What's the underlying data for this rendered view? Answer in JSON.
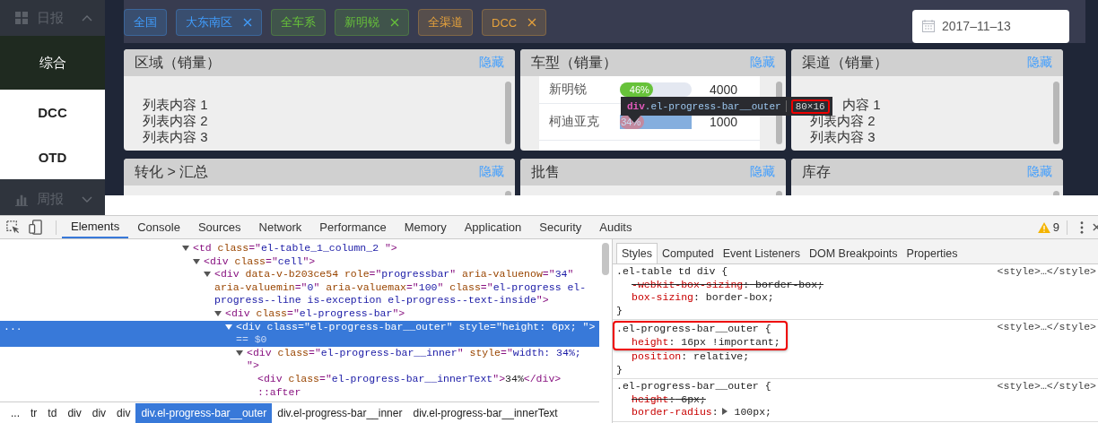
{
  "sidebar": {
    "groups": [
      {
        "label": "日报",
        "expanded": true,
        "items": [
          {
            "label": "综合",
            "selected": true
          },
          {
            "label": "DCC",
            "selected": false
          },
          {
            "label": "OTD",
            "selected": false
          }
        ]
      },
      {
        "label": "周报",
        "expanded": false
      }
    ]
  },
  "filter_tags": [
    {
      "label": "全国",
      "closable": false,
      "color": "#409eff"
    },
    {
      "label": "大东南区",
      "closable": true,
      "color": "#409eff"
    },
    {
      "label": "全车系",
      "closable": false,
      "color": "#67c23a"
    },
    {
      "label": "新明锐",
      "closable": true,
      "color": "#67c23a"
    },
    {
      "label": "全渠道",
      "closable": false,
      "color": "#e6a23c"
    },
    {
      "label": "DCC",
      "closable": true,
      "color": "#e6a23c"
    }
  ],
  "date_picker": {
    "value": "2017–11–13"
  },
  "panels": [
    {
      "title": "区域（销量）",
      "action": "隐藏",
      "kind": "list",
      "items": [
        {
          "text": "列表内容 1",
          "covered": false
        },
        {
          "text": "列表内容 2",
          "covered": false
        },
        {
          "text": "列表内容 3",
          "covered": false
        }
      ]
    },
    {
      "title": "车型（销量）",
      "action": "隐藏",
      "kind": "table",
      "rows": [
        {
          "name": "新明锐",
          "percent": "46%",
          "level": 0.46,
          "kind": "success",
          "inspected": false,
          "value": "4000"
        },
        {
          "name": "柯迪亚克",
          "percent": "34%",
          "level": 0.34,
          "kind": "exception",
          "inspected": true,
          "value": "1000"
        }
      ]
    },
    {
      "title": "渠道（销量）",
      "action": "隐藏",
      "kind": "list",
      "items": [
        {
          "text": "内容 1",
          "covered": true
        },
        {
          "text": "列表内容 2",
          "covered": false
        },
        {
          "text": "列表内容 3",
          "covered": false
        }
      ]
    },
    {
      "title": "转化 > 汇总",
      "action": "隐藏",
      "kind": "empty"
    },
    {
      "title": "批售",
      "action": "隐藏",
      "kind": "empty"
    },
    {
      "title": "库存",
      "action": "隐藏",
      "kind": "empty"
    }
  ],
  "inspect_tooltip": {
    "tag": "div",
    "classes": ".el-progress-bar__outer",
    "size": "80×16",
    "size_highlighted": true
  },
  "devtools": {
    "tabs": [
      {
        "label": "Elements",
        "selected": true
      },
      {
        "label": "Console",
        "selected": false
      },
      {
        "label": "Sources",
        "selected": false
      },
      {
        "label": "Network",
        "selected": false
      },
      {
        "label": "Performance",
        "selected": false
      },
      {
        "label": "Memory",
        "selected": false
      },
      {
        "label": "Application",
        "selected": false
      },
      {
        "label": "Security",
        "selected": false
      },
      {
        "label": "Audits",
        "selected": false
      }
    ],
    "warning_count": "9",
    "dom_tree": [
      {
        "expanded": true,
        "selected": false,
        "tokens": [
          {
            "kind": "tag",
            "t": "<td "
          },
          {
            "kind": "attr",
            "t": "class"
          },
          {
            "kind": "tag",
            "t": "=\""
          },
          {
            "kind": "val",
            "t": "el-table_1_column_2  "
          },
          {
            "kind": "tag",
            "t": "\">"
          }
        ],
        "children": [
          {
            "expanded": true,
            "selected": false,
            "tokens": [
              {
                "kind": "tag",
                "t": "<div "
              },
              {
                "kind": "attr",
                "t": "class"
              },
              {
                "kind": "tag",
                "t": "=\""
              },
              {
                "kind": "val",
                "t": "cell"
              },
              {
                "kind": "tag",
                "t": "\">"
              }
            ],
            "children": [
              {
                "expanded": true,
                "selected": false,
                "tokens": [
                  {
                    "kind": "tag",
                    "t": "<div "
                  },
                  {
                    "kind": "attr",
                    "t": "data-v-b203ce54 role"
                  },
                  {
                    "kind": "tag",
                    "t": "=\""
                  },
                  {
                    "kind": "val",
                    "t": "progressbar"
                  },
                  {
                    "kind": "tag",
                    "t": "\" "
                  },
                  {
                    "kind": "attr",
                    "t": "aria-valuenow"
                  },
                  {
                    "kind": "tag",
                    "t": "=\""
                  },
                  {
                    "kind": "val",
                    "t": "34"
                  },
                  {
                    "kind": "tag",
                    "t": "\" "
                  },
                  {
                    "kind": "attr",
                    "t": "aria-valuemin"
                  },
                  {
                    "kind": "tag",
                    "t": "=\""
                  },
                  {
                    "kind": "val",
                    "t": "0"
                  },
                  {
                    "kind": "tag",
                    "t": "\" "
                  },
                  {
                    "kind": "attr",
                    "t": "aria-valuemax"
                  },
                  {
                    "kind": "tag",
                    "t": "=\""
                  },
                  {
                    "kind": "val",
                    "t": "100"
                  },
                  {
                    "kind": "tag",
                    "t": "\" "
                  },
                  {
                    "kind": "attr",
                    "t": "class"
                  },
                  {
                    "kind": "tag",
                    "t": "=\""
                  },
                  {
                    "kind": "val",
                    "t": "el-progress el-progress--line is-exception el-progress--text-inside"
                  },
                  {
                    "kind": "tag",
                    "t": "\">"
                  }
                ],
                "children": [
                  {
                    "expanded": true,
                    "selected": false,
                    "tokens": [
                      {
                        "kind": "tag",
                        "t": "<div "
                      },
                      {
                        "kind": "attr",
                        "t": "class"
                      },
                      {
                        "kind": "tag",
                        "t": "=\""
                      },
                      {
                        "kind": "val",
                        "t": "el-progress-bar"
                      },
                      {
                        "kind": "tag",
                        "t": "\">"
                      }
                    ],
                    "children": [
                      {
                        "expanded": true,
                        "selected": true,
                        "gutter": "...",
                        "tokens": [
                          {
                            "kind": "tag",
                            "t": "<div "
                          },
                          {
                            "kind": "attr",
                            "t": "class"
                          },
                          {
                            "kind": "tag",
                            "t": "=\""
                          },
                          {
                            "kind": "val",
                            "t": "el-progress-bar__outer"
                          },
                          {
                            "kind": "tag",
                            "t": "\" "
                          },
                          {
                            "kind": "attr",
                            "t": "style"
                          },
                          {
                            "kind": "tag",
                            "t": "=\""
                          },
                          {
                            "kind": "val",
                            "t": "height: 6px; "
                          },
                          {
                            "kind": "tag",
                            "t": "\">"
                          },
                          {
                            "kind": "ref",
                            "t": " == $0"
                          }
                        ],
                        "children": [
                          {
                            "expanded": true,
                            "selected": false,
                            "tokens": [
                              {
                                "kind": "tag",
                                "t": "<div "
                              },
                              {
                                "kind": "attr",
                                "t": "class"
                              },
                              {
                                "kind": "tag",
                                "t": "=\""
                              },
                              {
                                "kind": "val",
                                "t": "el-progress-bar__inner"
                              },
                              {
                                "kind": "tag",
                                "t": "\" "
                              },
                              {
                                "kind": "attr",
                                "t": "style"
                              },
                              {
                                "kind": "tag",
                                "t": "=\""
                              },
                              {
                                "kind": "val",
                                "t": "width: 34%; "
                              },
                              {
                                "kind": "tag",
                                "t": "\">"
                              }
                            ],
                            "children": [
                              {
                                "selected": false,
                                "tokens": [
                                  {
                                    "kind": "tag",
                                    "t": "<div "
                                  },
                                  {
                                    "kind": "attr",
                                    "t": "class"
                                  },
                                  {
                                    "kind": "tag",
                                    "t": "=\""
                                  },
                                  {
                                    "kind": "val",
                                    "t": "el-progress-bar__innerText"
                                  },
                                  {
                                    "kind": "tag",
                                    "t": "\">"
                                  },
                                  {
                                    "kind": "text",
                                    "t": "34%"
                                  },
                                  {
                                    "kind": "tag",
                                    "t": "</div>"
                                  }
                                ]
                              },
                              {
                                "selected": false,
                                "tokens": [
                                  {
                                    "kind": "tag",
                                    "t": "::after"
                                  }
                                ]
                              }
                            ]
                          }
                        ]
                      }
                    ]
                  }
                ]
              }
            ]
          }
        ]
      }
    ],
    "breadcrumbs": [
      {
        "label": "...",
        "selected": false
      },
      {
        "label": "tr",
        "selected": false
      },
      {
        "label": "td",
        "selected": false
      },
      {
        "label": "div",
        "selected": false
      },
      {
        "label": "div",
        "selected": false
      },
      {
        "label": "div",
        "selected": false
      },
      {
        "label": "div.el-progress-bar__outer",
        "selected": true
      },
      {
        "label": "div.el-progress-bar__inner",
        "selected": false
      },
      {
        "label": "div.el-progress-bar__innerText",
        "selected": false
      }
    ],
    "style_tabs": [
      {
        "label": "Styles",
        "selected": true
      },
      {
        "label": "Computed",
        "selected": false
      },
      {
        "label": "Event Listeners",
        "selected": false
      },
      {
        "label": "DOM Breakpoints",
        "selected": false
      },
      {
        "label": "Properties",
        "selected": false
      }
    ],
    "rules": [
      {
        "selector": ".el-table td div {",
        "source": "<style>…</style>",
        "close": "}",
        "highlighted": false,
        "props": [
          {
            "name": "-webkit-box-sizing",
            "sep": ":",
            "value": " border-box;",
            "overridden": true,
            "expandable": false
          },
          {
            "name": "box-sizing",
            "sep": ":",
            "value": " border-box;",
            "overridden": false,
            "expandable": false
          }
        ]
      },
      {
        "selector": ".el-progress-bar__outer {",
        "source": "<style>…</style>",
        "close": "}",
        "highlighted": true,
        "props": [
          {
            "name": "height",
            "sep": ":",
            "value": " 16px !important;",
            "overridden": false,
            "expandable": false
          },
          {
            "name": "position",
            "sep": ":",
            "value": " relative;",
            "overridden": false,
            "expandable": false
          }
        ]
      },
      {
        "selector": ".el-progress-bar__outer {",
        "source": "<style>…</style>",
        "highlighted": false,
        "props": [
          {
            "name": "height",
            "sep": ":",
            "value": " 6px;",
            "overridden": true,
            "expandable": false
          },
          {
            "name": "border-radius",
            "sep": ":",
            "value": " 100px;",
            "overridden": false,
            "expandable": true
          }
        ]
      }
    ]
  }
}
